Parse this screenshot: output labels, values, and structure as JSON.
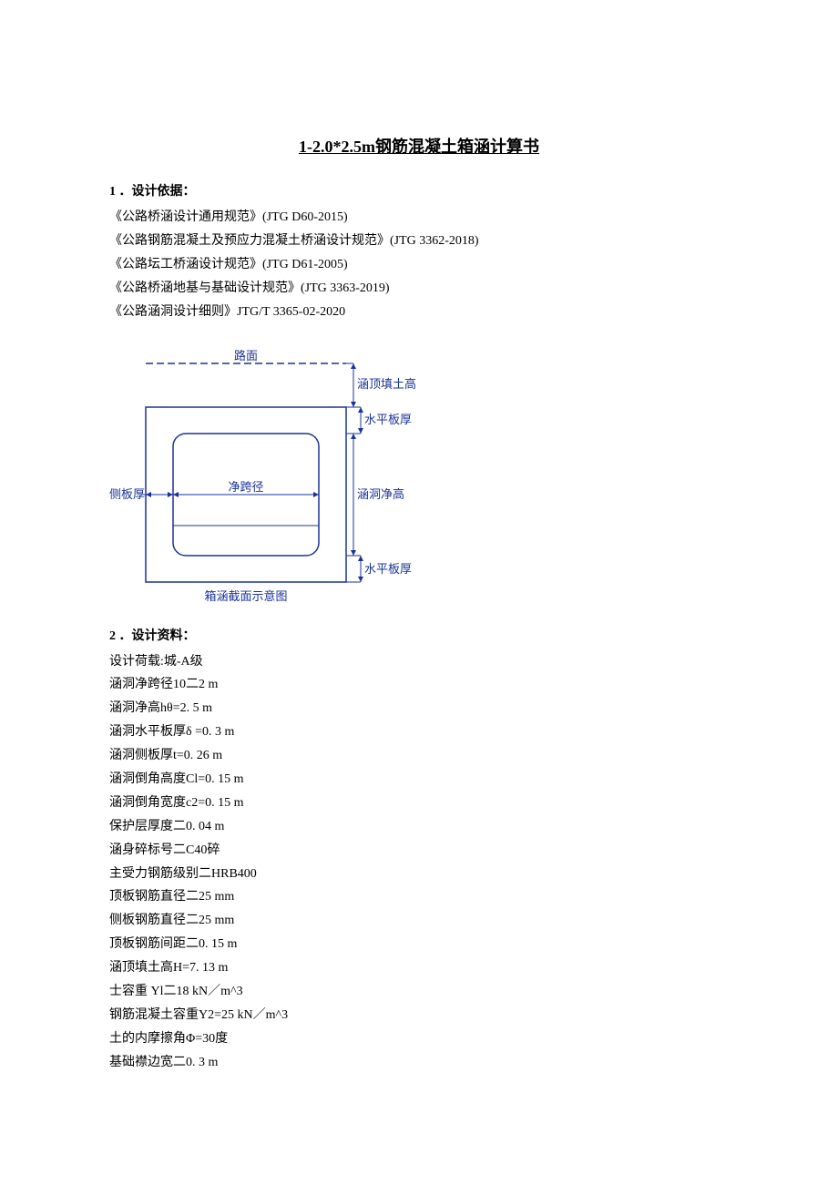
{
  "title": "1-2.0*2.5m钢筋混凝土箱涵计算书",
  "section1": {
    "header": "1 ．设计依据：",
    "refs": [
      "《公路桥涵设计通用规范》(JTG D60-2015)",
      "《公路钢筋混凝土及预应力混凝土桥涵设计规范》(JTG 3362-2018)",
      "《公路坛工桥涵设计规范》(JTG D61-2005)",
      "《公路桥涵地基与基础设计规范》(JTG 3363-2019)",
      "《公路涵洞设计细则》JTG/T 3365-02-2020"
    ]
  },
  "diagram": {
    "top_label": "路面",
    "fill_height_label": "涵顶填土高",
    "horiz_plate_label": "水平板厚",
    "side_plate_label": "侧板厚",
    "net_span_label": "净跨径",
    "net_height_label": "涵洞净高",
    "horiz_plate_label2": "水平板厚",
    "caption": "箱涵截面示意图"
  },
  "section2": {
    "header": "2 ．设计资料：",
    "specs": [
      "设计荷载:城-A级",
      "涵洞净跨径10二2 m",
      "涵洞净高hθ=2. 5 m",
      "涵洞水平板厚δ =0. 3 m",
      "涵洞侧板厚t=0. 26 m",
      "涵洞倒角高度Cl=0. 15 m",
      "涵洞倒角宽度c2=0. 15 m",
      "保护层厚度二0. 04 m",
      "涵身碎标号二C40碎",
      "主受力钢筋级别二HRB400",
      "顶板钢筋直径二25 mm",
      "侧板钢筋直径二25 mm",
      "顶板钢筋间距二0. 15 m",
      "涵顶填土高H=7. 13 m",
      "士容重 Yl二18 kN／m^3",
      "钢筋混凝土容重Y2=25 kN／m^3",
      "土的内摩擦角Φ=30度",
      "基础襟边宽二0. 3 m"
    ]
  }
}
